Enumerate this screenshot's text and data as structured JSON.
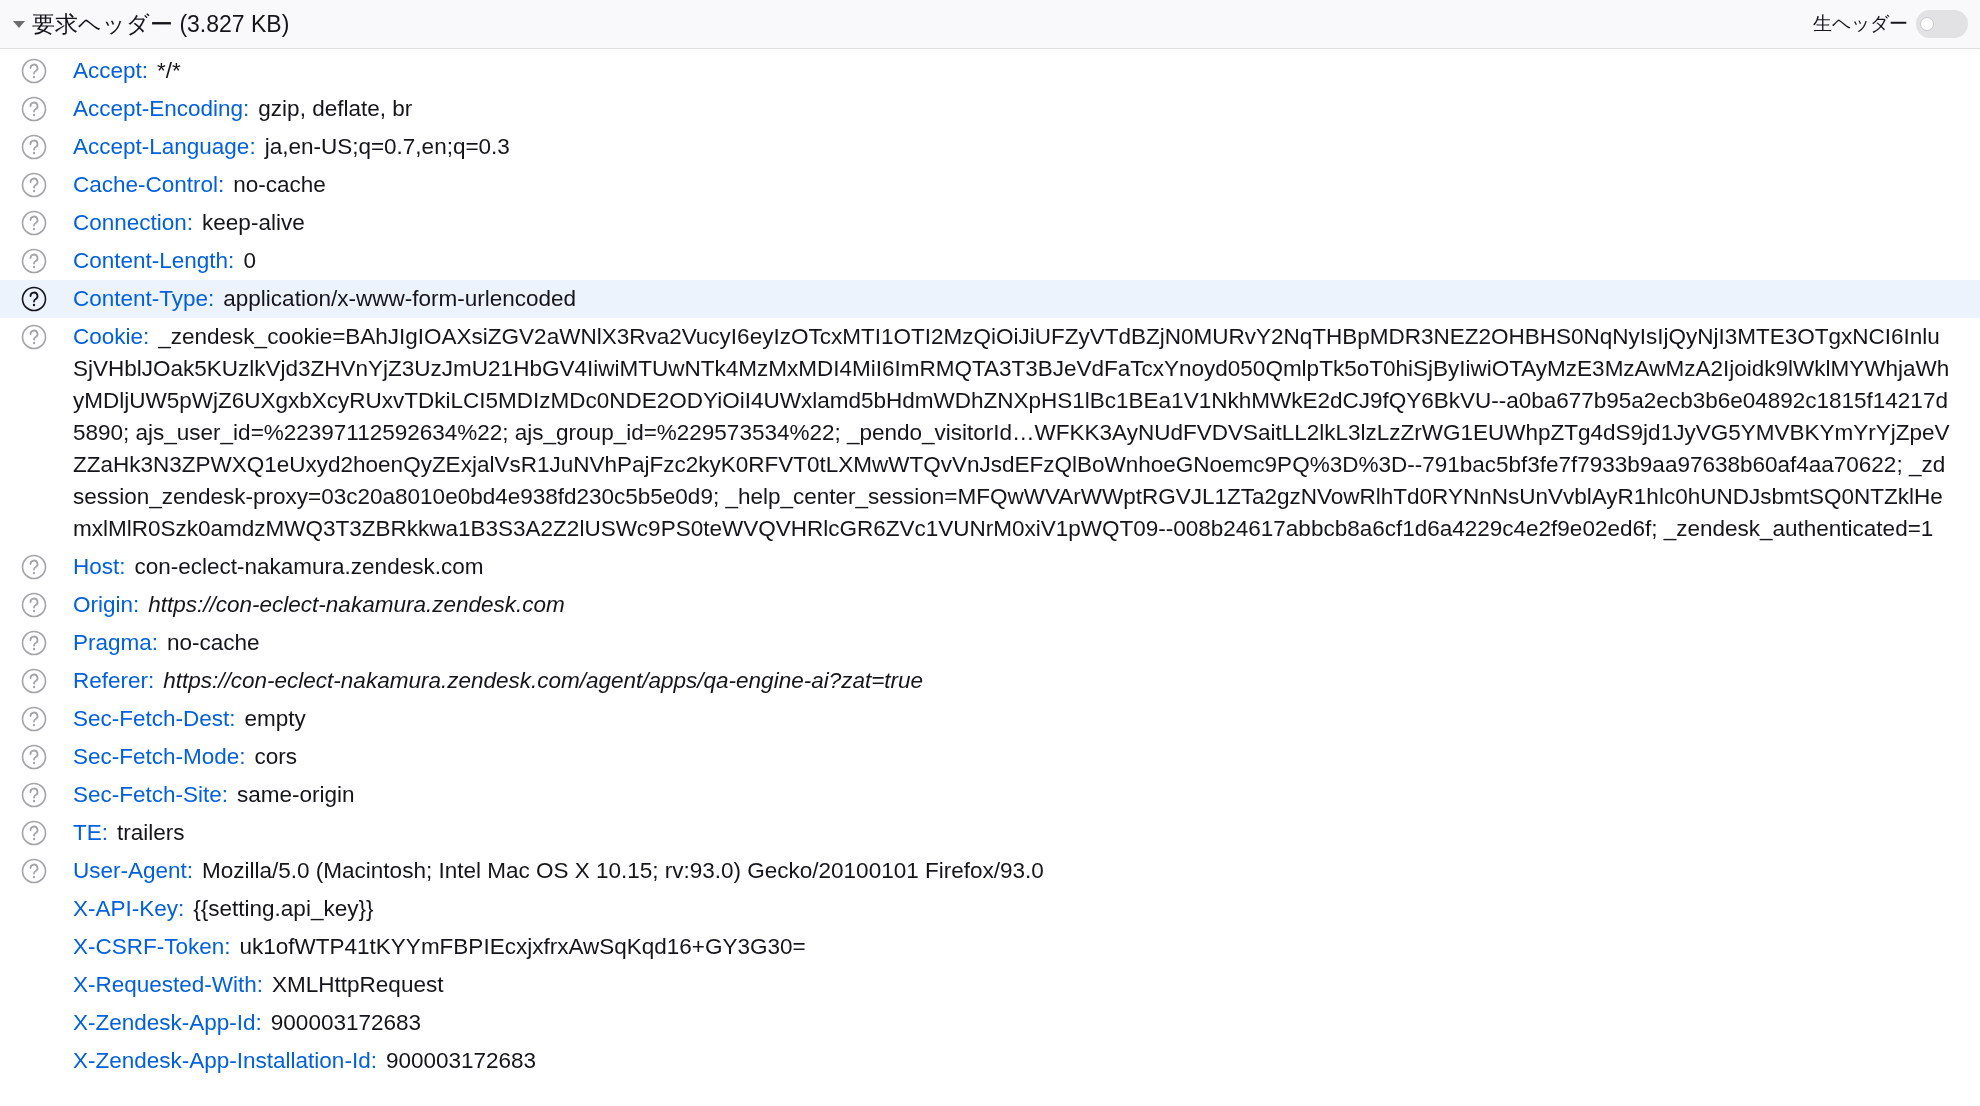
{
  "section": {
    "title": "要求ヘッダー (3.827 KB)",
    "expanded": true,
    "raw_toggle": {
      "label": "生ヘッダー",
      "on": false
    }
  },
  "headers": [
    {
      "name": "Accept:",
      "value": "*/*",
      "kind": "text",
      "help": true,
      "selected": false
    },
    {
      "name": "Accept-Encoding:",
      "value": "gzip, deflate, br",
      "kind": "text",
      "help": true,
      "selected": false
    },
    {
      "name": "Accept-Language:",
      "value": "ja,en-US;q=0.7,en;q=0.3",
      "kind": "text",
      "help": true,
      "selected": false
    },
    {
      "name": "Cache-Control:",
      "value": "no-cache",
      "kind": "text",
      "help": true,
      "selected": false
    },
    {
      "name": "Connection:",
      "value": "keep-alive",
      "kind": "text",
      "help": true,
      "selected": false
    },
    {
      "name": "Content-Length:",
      "value": "0",
      "kind": "text",
      "help": true,
      "selected": false
    },
    {
      "name": "Content-Type:",
      "value": "application/x-www-form-urlencoded",
      "kind": "text",
      "help": true,
      "selected": true
    },
    {
      "name": "Cookie:",
      "value": "_zendesk_cookie=BAhJIgIOAXsiZGV2aWNlX3Rva2VucyI6eyIzOTcxMTI1OTI2MzQiOiJiUFZyVTdBZjN0MURvY2NqTHBpMDR3NEZ2OHBHS0NqNyIsIjQyNjI3MTE3OTgxNCI6InluSjVHblJOak5KUzlkVjd3ZHVnYjZ3UzJmU21HbGV4IiwiMTUwNTk4MzMxMDI4MiI6ImRMQTA3T3BJeVdFaTcxYnoyd050QmlpTk5oT0hiSjByIiwiOTAyMzE3MzAwMzA2Ijoidk9lWklMYWhjaWhyMDljUW5pWjZ6UXgxbXcyRUxvTDkiLCI5MDIzMDc0NDE2ODYiOiI4UWxlamd5bHdmWDhZNXpHS1lBc1BEa1V1NkhMWkE2dCJ9fQY6BkVU--a0ba677b95a2ecb3b6e04892c1815f14217d5890; ajs_user_id=%22397112592634%22; ajs_group_id=%229573534%22; _pendo_visitorId…WFKK3AyNUdFVDVSaitLL2lkL3lzLzZrWG1EUWhpZTg4dS9jd1JyVG5YMVBKYmYrYjZpeVZZaHk3N3ZPWXQ1eUxyd2hoenQyZExjalVsR1JuNVhPajFzc2kyK0RFVT0tLXMwWTQvVnJsdEFzQlBoWnhoeGNoemc9PQ%3D%3D--791bac5bf3fe7f7933b9aa97638b60af4aa70622; _zdsession_zendesk-proxy=03c20a8010e0bd4e938fd230c5b5e0d9; _help_center_session=MFQwWVArWWptRGVJL1ZTa2gzNVowRlhTd0RYNnNsUnVvblAyR1hlc0hUNDJsbmtSQ0NTZklHemxlMlR0Szk0amdzMWQ3T3ZBRkkwa1B3S3A2Z2lUSWc9PS0teWVQVHRlcGR6ZVc1VUNrM0xiV1pWQT09--008b24617abbcb8a6cf1d6a4229c4e2f9e02ed6f; _zendesk_authenticated=1",
      "kind": "long",
      "help": true,
      "selected": false
    },
    {
      "name": "Host:",
      "value": "con-eclect-nakamura.zendesk.com",
      "kind": "text",
      "help": true,
      "selected": false
    },
    {
      "name": "Origin:",
      "value": "https://con-eclect-nakamura.zendesk.com",
      "kind": "url",
      "help": true,
      "selected": false
    },
    {
      "name": "Pragma:",
      "value": "no-cache",
      "kind": "text",
      "help": true,
      "selected": false
    },
    {
      "name": "Referer:",
      "value": "https://con-eclect-nakamura.zendesk.com/agent/apps/qa-engine-ai?zat=true",
      "kind": "url",
      "help": true,
      "selected": false
    },
    {
      "name": "Sec-Fetch-Dest:",
      "value": "empty",
      "kind": "text",
      "help": true,
      "selected": false
    },
    {
      "name": "Sec-Fetch-Mode:",
      "value": "cors",
      "kind": "text",
      "help": true,
      "selected": false
    },
    {
      "name": "Sec-Fetch-Site:",
      "value": "same-origin",
      "kind": "text",
      "help": true,
      "selected": false
    },
    {
      "name": "TE:",
      "value": "trailers",
      "kind": "text",
      "help": true,
      "selected": false
    },
    {
      "name": "User-Agent:",
      "value": "Mozilla/5.0 (Macintosh; Intel Mac OS X 10.15; rv:93.0) Gecko/20100101 Firefox/93.0",
      "kind": "text",
      "help": true,
      "selected": false
    },
    {
      "name": "X-API-Key:",
      "value": "{{setting.api_key}}",
      "kind": "text",
      "help": false,
      "selected": false
    },
    {
      "name": "X-CSRF-Token:",
      "value": "uk1ofWTP41tKYYmFBPIEcxjxfrxAwSqKqd16+GY3G30=",
      "kind": "text",
      "help": false,
      "selected": false
    },
    {
      "name": "X-Requested-With:",
      "value": "XMLHttpRequest",
      "kind": "text",
      "help": false,
      "selected": false
    },
    {
      "name": "X-Zendesk-App-Id:",
      "value": "900003172683",
      "kind": "text",
      "help": false,
      "selected": false
    },
    {
      "name": "X-Zendesk-App-Installation-Id:",
      "value": "900003172683",
      "kind": "text",
      "help": false,
      "selected": false
    }
  ]
}
